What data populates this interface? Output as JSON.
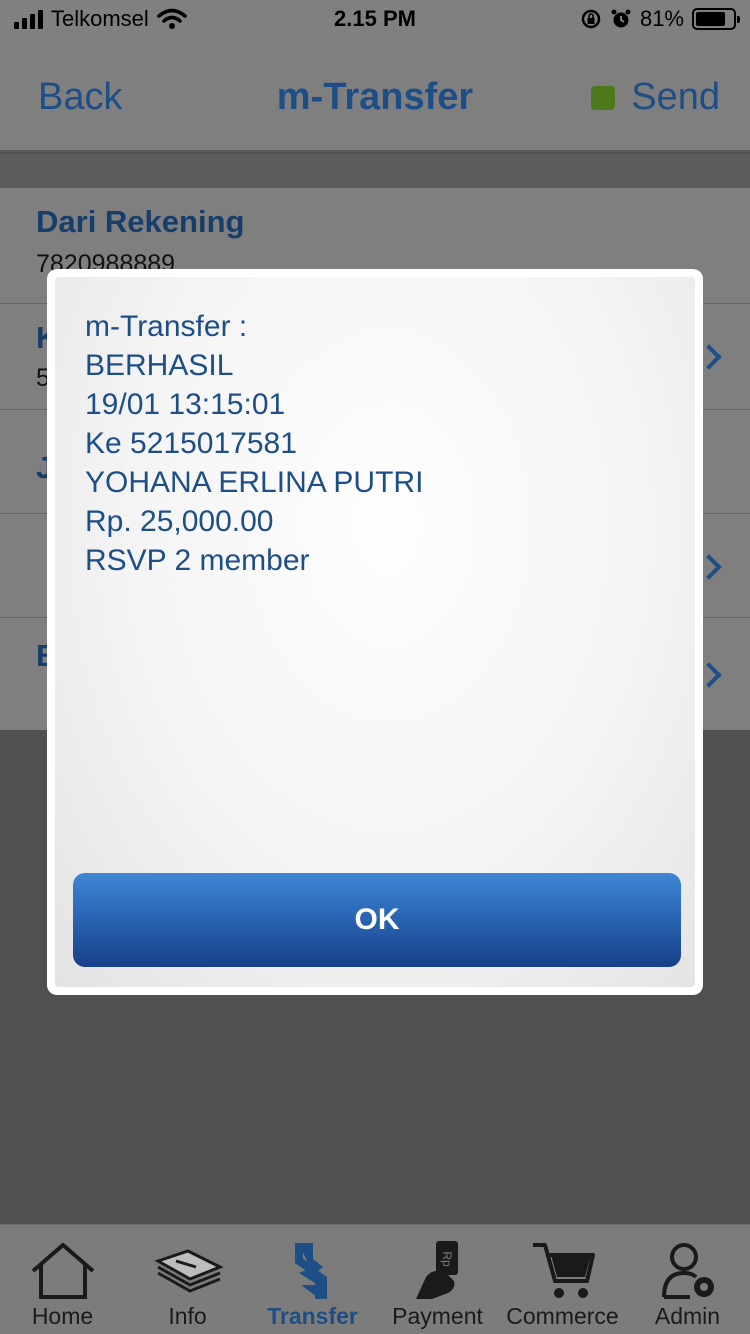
{
  "status_bar": {
    "carrier": "Telkomsel",
    "time": "2.15 PM",
    "battery": "81%",
    "battery_level": 0.81
  },
  "nav": {
    "back_label": "Back",
    "title": "m-Transfer",
    "send_label": "Send",
    "send_indicator_color": "#4c7a1a"
  },
  "form": {
    "rows": [
      {
        "label": "Dari Rekening",
        "value": "7820988889"
      },
      {
        "label": "K",
        "value": "5"
      },
      {
        "label": "J",
        "value": ""
      },
      {
        "label": "",
        "value": ""
      },
      {
        "label": "B",
        "value": ""
      }
    ]
  },
  "dialog": {
    "lines": [
      "m-Transfer :",
      "BERHASIL",
      "19/01 13:15:01",
      "Ke 5215017581",
      "YOHANA ERLINA PUTRI",
      "Rp. 25,000.00",
      "RSVP 2 member"
    ],
    "ok_label": "OK"
  },
  "tabs": [
    {
      "label": "Home",
      "icon": "home-icon"
    },
    {
      "label": "Info",
      "icon": "info-icon"
    },
    {
      "label": "Transfer",
      "icon": "transfer-icon",
      "active": true
    },
    {
      "label": "Payment",
      "icon": "payment-icon"
    },
    {
      "label": "Commerce",
      "icon": "cart-icon"
    },
    {
      "label": "Admin",
      "icon": "admin-icon"
    }
  ],
  "colors": {
    "accent": "#1d4f86",
    "ok_button": "#2a67b4"
  }
}
